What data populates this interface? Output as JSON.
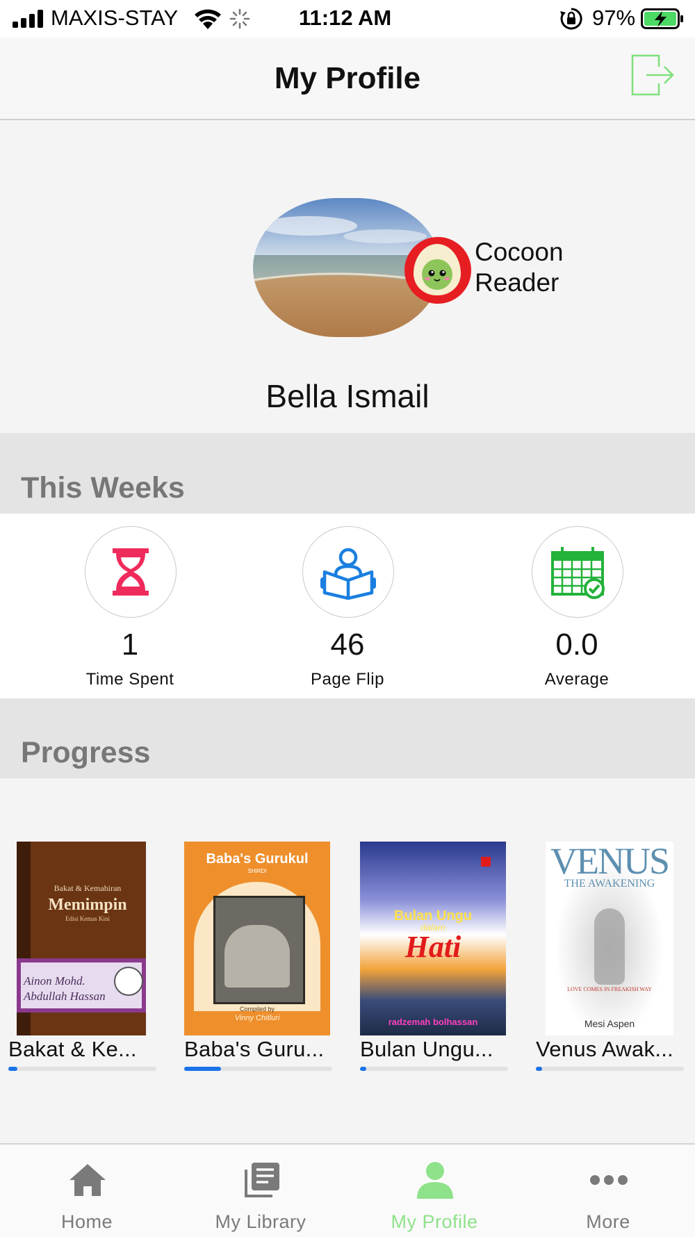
{
  "status_bar": {
    "carrier": "MAXIS-STAY",
    "time": "11:12 AM",
    "battery": "97%"
  },
  "header": {
    "title": "My Profile",
    "logout_icon": "logout-icon",
    "accent_color": "#7ee07a"
  },
  "profile": {
    "avatar_image": "beach-photo",
    "badge_icon": "egg-character-icon",
    "rank_line1": "Cocoon",
    "rank_line2": "Reader",
    "name": "Bella Ismail"
  },
  "this_week": {
    "heading": "This Weeks",
    "stats": [
      {
        "icon": "hourglass-icon",
        "value": "1",
        "label": "Time Spent",
        "color": "#ef2b5c"
      },
      {
        "icon": "reader-icon",
        "value": "46",
        "label": "Page Flip",
        "color": "#1a7fe0"
      },
      {
        "icon": "calendar-check-icon",
        "value": "0.0",
        "label": "Average",
        "color": "#23b23a"
      }
    ]
  },
  "progress": {
    "heading": "Progress",
    "books": [
      {
        "title": "Bakat & Ke...",
        "cover": {
          "line1": "Bakat & Kemahiran",
          "line2": "Memimpin",
          "line3": "Edisi Kemas Kini",
          "author": "Ainon Mohd. Abdullah Hassan"
        },
        "progress": 0.06
      },
      {
        "title": "Baba's Guru...",
        "cover": {
          "line1": "Baba's Gurukul",
          "line2": "SHIRDI",
          "line3": "Compiled by",
          "author": "Vinny Chitluri"
        },
        "progress": 0.25
      },
      {
        "title": "Bulan Ungu...",
        "cover": {
          "line1": "Bulan Ungu",
          "line2": "dalam",
          "line3": "Hati",
          "author": "radzemah bolhassan"
        },
        "progress": 0.04
      },
      {
        "title": "Venus Awak...",
        "cover": {
          "line1": "VENUS",
          "line2": "THE AWAKENING",
          "line3": "LOVE COMES IN FREAKISH WAY",
          "author": "Mesi Aspen"
        },
        "progress": 0.04
      }
    ]
  },
  "tab_bar": {
    "tabs": [
      {
        "label": "Home",
        "icon": "home-icon",
        "active": false
      },
      {
        "label": "My Library",
        "icon": "library-icon",
        "active": false
      },
      {
        "label": "My Profile",
        "icon": "profile-icon",
        "active": true
      },
      {
        "label": "More",
        "icon": "more-icon",
        "active": false
      }
    ],
    "active_color": "#8ee28a",
    "inactive_color": "#7a7a7a"
  }
}
